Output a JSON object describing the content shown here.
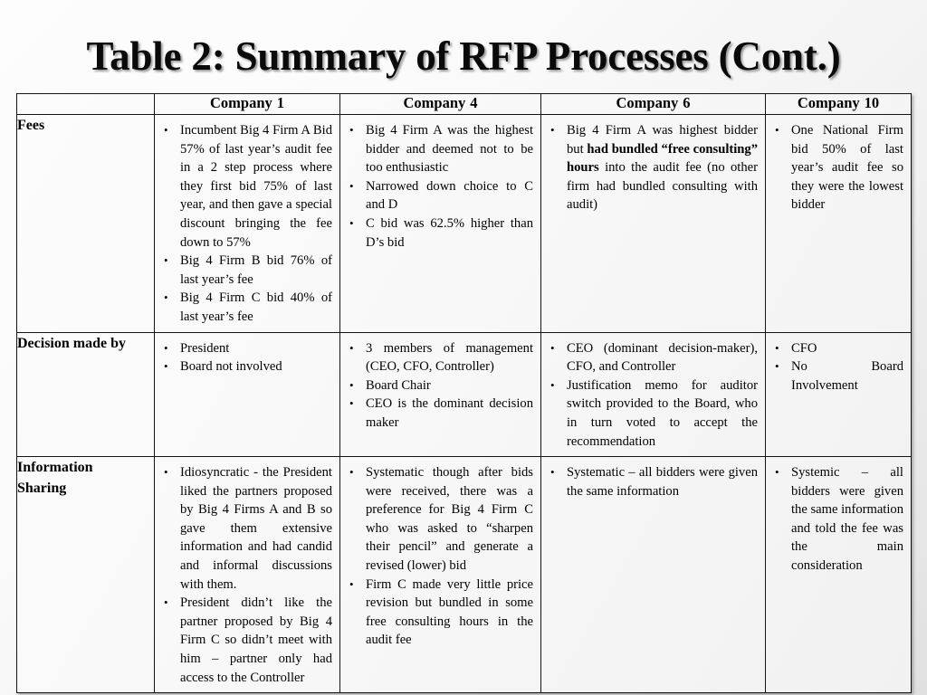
{
  "slide": {
    "title": "Table 2: Summary of RFP Processes (Cont.)"
  },
  "table": {
    "corner_label": "",
    "columns": [
      {
        "label": "Company",
        "number": "1"
      },
      {
        "label": "Company",
        "number": "4"
      },
      {
        "label": "Company",
        "number": "6"
      },
      {
        "label": "Company",
        "number": "10"
      }
    ],
    "rows": [
      {
        "label": "Fees",
        "label_lines": [
          "Fees"
        ],
        "cells": {
          "company_1": [
            "Incumbent Big 4 Firm A Bid 57% of last year’s audit fee in a 2 step process where they first bid 75% of last year, and then gave a special discount bringing the fee down to 57%",
            "Big 4 Firm B bid 76% of last year’s fee",
            "Big 4 Firm C bid 40% of last year’s fee"
          ],
          "company_4": [
            "Big 4 Firm A was the highest bidder and deemed not to be too enthusiastic",
            "Narrowed down choice to C and D",
            "C bid was 62.5% higher than D’s bid"
          ],
          "company_6": [
            {
              "parts": [
                {
                  "text": "Big 4 Firm A was highest bidder but ",
                  "bold": false
                },
                {
                  "text": "had bundled “free consulting” hours",
                  "bold": true
                },
                {
                  "text": " into the audit fee (no other firm had bundled consulting with audit)",
                  "bold": false
                }
              ]
            }
          ],
          "company_10": [
            "One National Firm bid 50% of last year’s audit fee so they were the lowest bidder"
          ]
        }
      },
      {
        "label": "Decision made by",
        "label_lines": [
          "Decision made by"
        ],
        "cells": {
          "company_1": [
            "President",
            "Board not involved"
          ],
          "company_4": [
            "3 members of management (CEO, CFO, Controller)",
            "Board Chair",
            "CEO is the dominant decision maker"
          ],
          "company_6": [
            "CEO (dominant decision-maker), CFO, and Controller",
            "Justification memo for auditor switch provided to the Board, who in turn voted to accept the recommendation"
          ],
          "company_10": [
            "CFO",
            "No Board Involvement"
          ]
        }
      },
      {
        "label": "Information Sharing",
        "label_lines": [
          "Information",
          "Sharing"
        ],
        "cells": {
          "company_1": [
            "Idiosyncratic - the President liked the partners proposed by Big 4 Firms A and B so gave them extensive information and had candid and informal discussions with them.",
            "President didn’t like the partner proposed by Big 4 Firm C so didn’t meet with him – partner only had access to the Controller"
          ],
          "company_4": [
            "Systematic though after bids were received, there was a preference for Big 4 Firm C who was asked to “sharpen their pencil” and generate a revised (lower) bid",
            "Firm C made very little price revision but bundled in some free consulting hours in the audit fee"
          ],
          "company_6": [
            "Systematic – all bidders were given the same information"
          ],
          "company_10": [
            "Systemic – all bidders were given the same information and told the fee was the main consideration"
          ]
        }
      }
    ]
  },
  "style": {
    "border_color": "#141414",
    "text_color": "#000000",
    "background": "#f4f4f4"
  }
}
